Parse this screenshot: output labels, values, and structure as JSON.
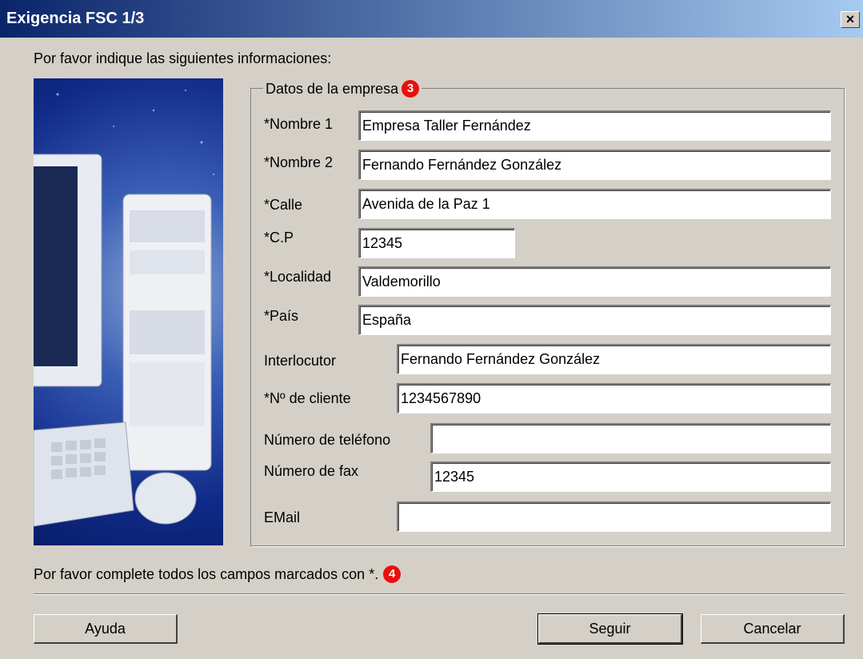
{
  "window": {
    "title": "Exigencia FSC 1/3",
    "close_glyph": "×"
  },
  "intro": "Por favor indique las siguientes informaciones:",
  "group": {
    "legend": "Datos de la empresa",
    "badge": "3"
  },
  "fields": [
    {
      "label": "*Nombre 1",
      "value": "Empresa Taller Fernández"
    },
    {
      "label": "*Nombre 2",
      "value": "Fernando Fernández González"
    },
    {
      "label": "*Calle",
      "value": "Avenida de la Paz 1"
    },
    {
      "label": "*C.P",
      "value": "12345"
    },
    {
      "label": "*Localidad",
      "value": "Valdemorillo"
    },
    {
      "label": "*País",
      "value": "España"
    },
    {
      "label": "Interlocutor",
      "value": "Fernando Fernández González"
    },
    {
      "label": "*Nº de cliente",
      "value": "1234567890"
    },
    {
      "label": "Número de teléfono",
      "value": ""
    },
    {
      "label": "Número de fax",
      "value": "12345"
    },
    {
      "label": "EMail",
      "value": ""
    }
  ],
  "footer": {
    "note": "Por favor complete todos los campos marcados con *.",
    "badge": "4"
  },
  "buttons": {
    "help": "Ayuda",
    "next": "Seguir",
    "cancel": "Cancelar"
  },
  "colors": {
    "title_start": "#0a246a",
    "title_end": "#a6caf0",
    "badge": "#e8100c"
  }
}
